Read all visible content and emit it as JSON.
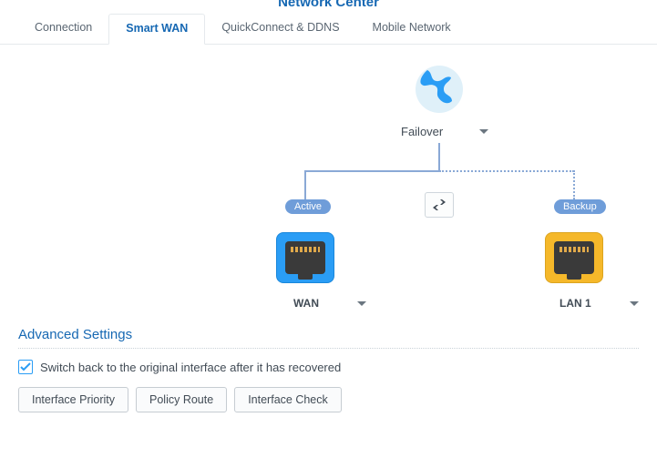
{
  "header": {
    "title": "Network Center"
  },
  "tabs": [
    {
      "label": "Connection",
      "active": false
    },
    {
      "label": "Smart WAN",
      "active": true
    },
    {
      "label": "QuickConnect & DDNS",
      "active": false
    },
    {
      "label": "Mobile Network",
      "active": false
    }
  ],
  "diagram": {
    "mode_label": "Failover",
    "active_badge": "Active",
    "backup_badge": "Backup",
    "wan_label": "WAN",
    "lan_label": "LAN 1"
  },
  "advanced": {
    "section_title": "Advanced Settings",
    "switch_back_label": "Switch back to the original interface after it has recovered",
    "switch_back_checked": true,
    "buttons": {
      "interface_priority": "Interface Priority",
      "policy_route": "Policy Route",
      "interface_check": "Interface Check"
    }
  }
}
